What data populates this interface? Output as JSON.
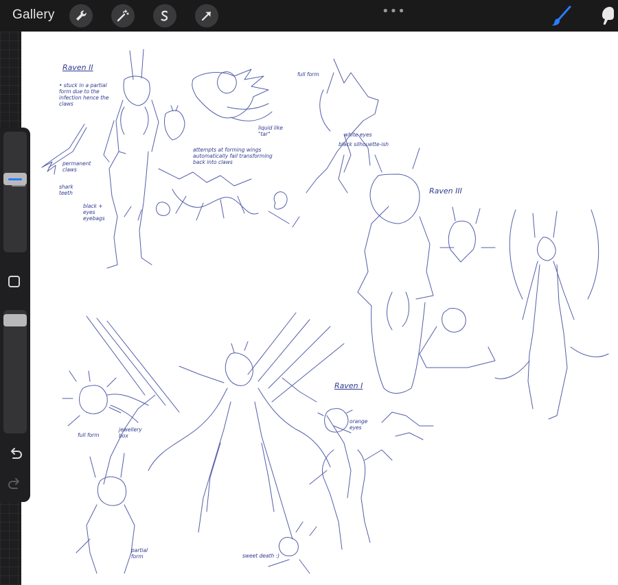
{
  "topbar": {
    "gallery_label": "Gallery",
    "tools": [
      "wrench-icon",
      "magic-wand-icon",
      "selection-icon",
      "transform-arrow-icon"
    ],
    "more_dots": "•••",
    "brush_icon": "brush-icon",
    "smudge_icon": "smudge-icon"
  },
  "sidebar": {
    "size_level": 0.62,
    "opacity_level": 0.04,
    "modify_button_icon": "square-icon",
    "undo_icon": "undo-icon",
    "redo_icon": "redo-icon"
  },
  "colors": {
    "accent": "#2b7bff",
    "ink": "#2e3a8c",
    "bar": "#1a1a1a",
    "canvas": "#ffffff"
  },
  "canvas_notes": {
    "raven2_title": "Raven II",
    "raven2_desc": "• stuck in a partial form due to the infection hence the claws",
    "permanent_claws": "permanent claws",
    "shark_teeth": "shark teeth",
    "black_eyes": "black + eyes eyebags",
    "liquid": "liquid like \"tar\"",
    "wings_attempt": "attempts at forming wings automatically fail transforming back into claws",
    "full_form_top": "full form",
    "white_eyes": "white eyes",
    "black_silhouette": "black silhouette-ish",
    "raven3_title": "Raven III",
    "raven1_title": "Raven I",
    "orange_eyes": "orange eyes",
    "full_form_bottom": "full form",
    "jewellery_box": "jewellery box",
    "partial_form": "partial form",
    "sweet_death": "sweet death :)"
  }
}
